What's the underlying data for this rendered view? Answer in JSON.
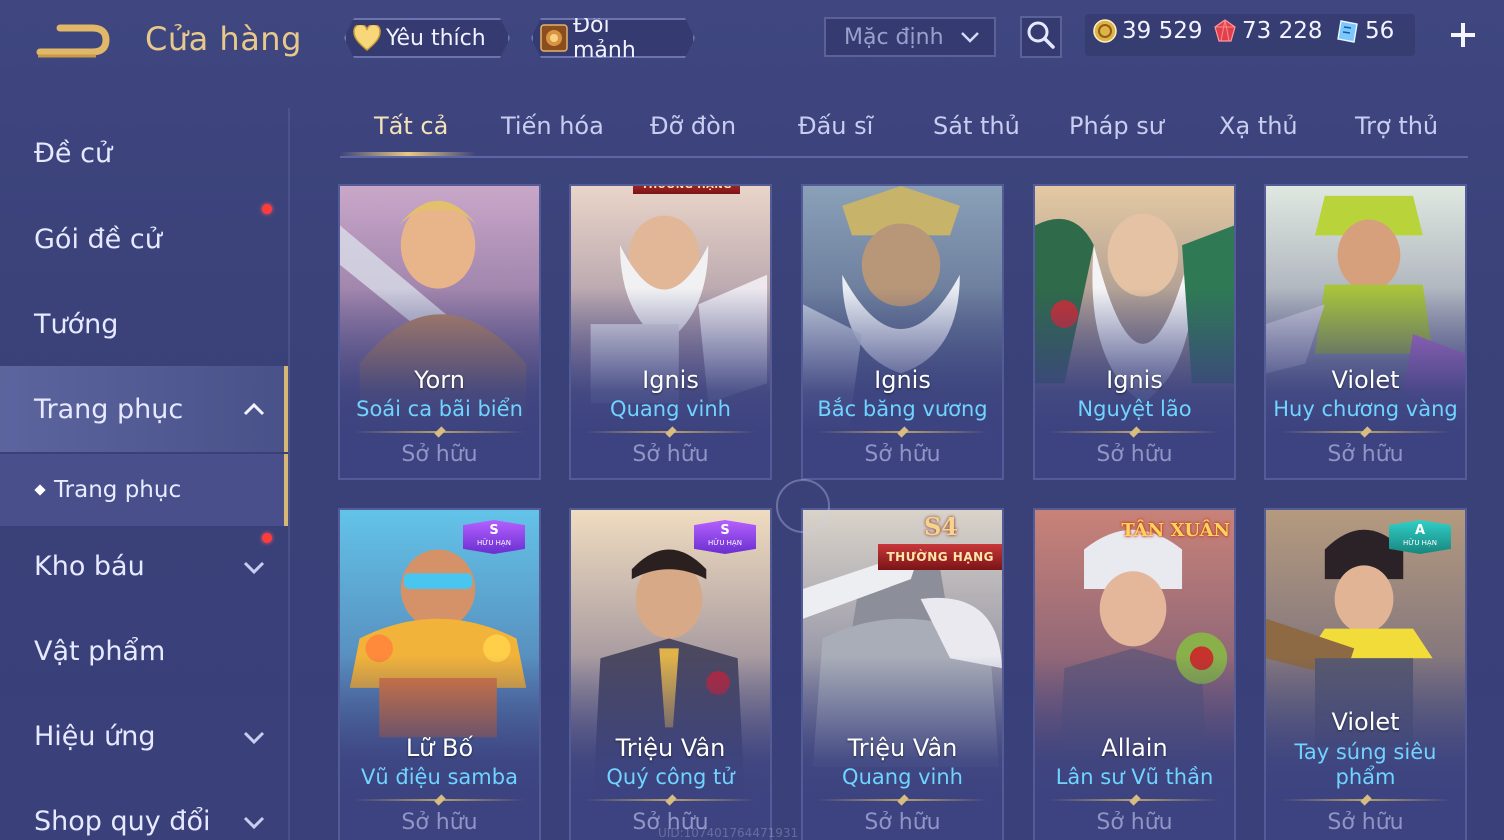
{
  "header": {
    "title": "Cửa hàng",
    "favorites_label": "Yêu thích",
    "trade_label": "Đổi mảnh",
    "sort": {
      "selected": "Mặc định"
    },
    "currencies": [
      {
        "name": "gold-coin",
        "value": "39 529"
      },
      {
        "name": "ruby",
        "value": "73 228"
      },
      {
        "name": "voucher",
        "value": "56"
      }
    ]
  },
  "sidebar": {
    "items": [
      {
        "label": "Đề cử"
      },
      {
        "label": "Gói đề cử"
      },
      {
        "label": "Tướng"
      },
      {
        "label": "Trang phục"
      },
      {
        "label": "Kho báu"
      },
      {
        "label": "Vật phẩm"
      },
      {
        "label": "Hiệu ứng"
      },
      {
        "label": "Shop quy đổi"
      }
    ],
    "sub_item": "Trang phục"
  },
  "tabs": [
    {
      "label": "Tất cả"
    },
    {
      "label": "Tiến hóa"
    },
    {
      "label": "Đỡ đòn"
    },
    {
      "label": "Đấu sĩ"
    },
    {
      "label": "Sát thủ"
    },
    {
      "label": "Pháp sư"
    },
    {
      "label": "Xạ thủ"
    },
    {
      "label": "Trợ thủ"
    }
  ],
  "cards": [
    {
      "hero": "Yorn",
      "skin": "Soái ca bãi biển",
      "status": "Sở hữu"
    },
    {
      "hero": "Ignis",
      "skin": "Quang vinh",
      "status": "Sở hữu",
      "ribbon": "THƯỜNG HẠNG"
    },
    {
      "hero": "Ignis",
      "skin": "Bắc băng vương",
      "status": "Sở hữu"
    },
    {
      "hero": "Ignis",
      "skin": "Nguyệt lão",
      "status": "Sở hữu"
    },
    {
      "hero": "Violet",
      "skin": "Huy chương vàng",
      "status": "Sở hữu"
    },
    {
      "hero": "Lữ Bố",
      "skin": "Vũ điệu samba",
      "status": "Sở hữu",
      "badge": "S",
      "badge_sub": "HỮU HẠN"
    },
    {
      "hero": "Triệu Vân",
      "skin": "Quý công tử",
      "status": "Sở hữu",
      "badge": "S",
      "badge_sub": "HỮU HẠN"
    },
    {
      "hero": "Triệu Vân",
      "skin": "Quang vinh",
      "status": "Sở hữu",
      "mark": "S4",
      "ribbon": "THƯỜNG HẠNG"
    },
    {
      "hero": "Allain",
      "skin": "Lân sư Vũ thần",
      "status": "Sở hữu",
      "logo": "TÂN XUÂN"
    },
    {
      "hero": "Violet",
      "skin": "Tay súng siêu phẩm",
      "status": "Sở hữu",
      "badge": "A",
      "badge_sub": "HỮU HẠN"
    }
  ],
  "uid": "UID:107401764471931"
}
